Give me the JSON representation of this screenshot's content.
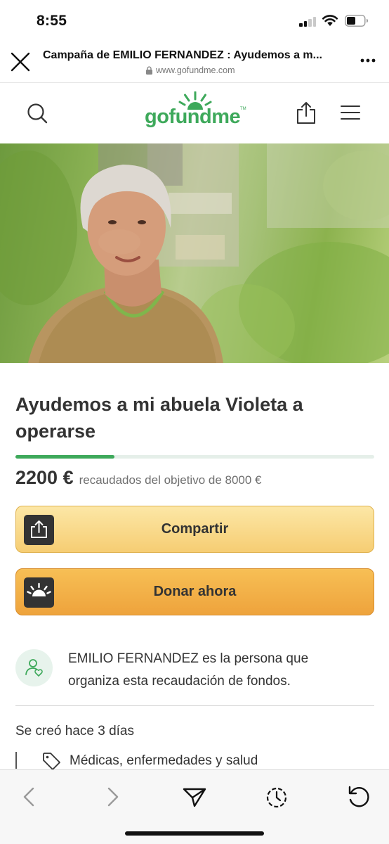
{
  "status": {
    "time": "8:55"
  },
  "browser": {
    "page_title": "Campaña de EMILIO FERNANDEZ : Ayudemos a m...",
    "url": "www.gofundme.com"
  },
  "site": {
    "logo_text": "gofundme",
    "logo_mark": "TM"
  },
  "hero": {
    "description_icon": "elderly-woman-photo"
  },
  "campaign": {
    "title": "Ayudemos a mi abuela Violeta a operarse",
    "raised": "2200 €",
    "goal_text": "recaudados del objetivo de 8000 €",
    "progress_fraction": 0.275
  },
  "actions": {
    "share_label": "Compartir",
    "donate_label": "Donar ahora"
  },
  "organizer": {
    "text": "EMILIO FERNANDEZ es la persona que organiza esta recaudación de fondos."
  },
  "meta": {
    "created": "Se creó hace 3 días",
    "category": "Médicas, enfermedades y salud"
  },
  "colors": {
    "brand_green": "#3ea95b",
    "share_button": "#f6cd73",
    "donate_button": "#eea33c",
    "text": "#333333"
  },
  "icons": [
    "close-icon",
    "lock-icon",
    "more-icon",
    "search-icon",
    "share-icon",
    "menu-icon",
    "heart-hands-icon",
    "organizer-icon",
    "tag-icon",
    "back-icon",
    "forward-icon",
    "send-icon",
    "history-icon",
    "reload-icon"
  ]
}
